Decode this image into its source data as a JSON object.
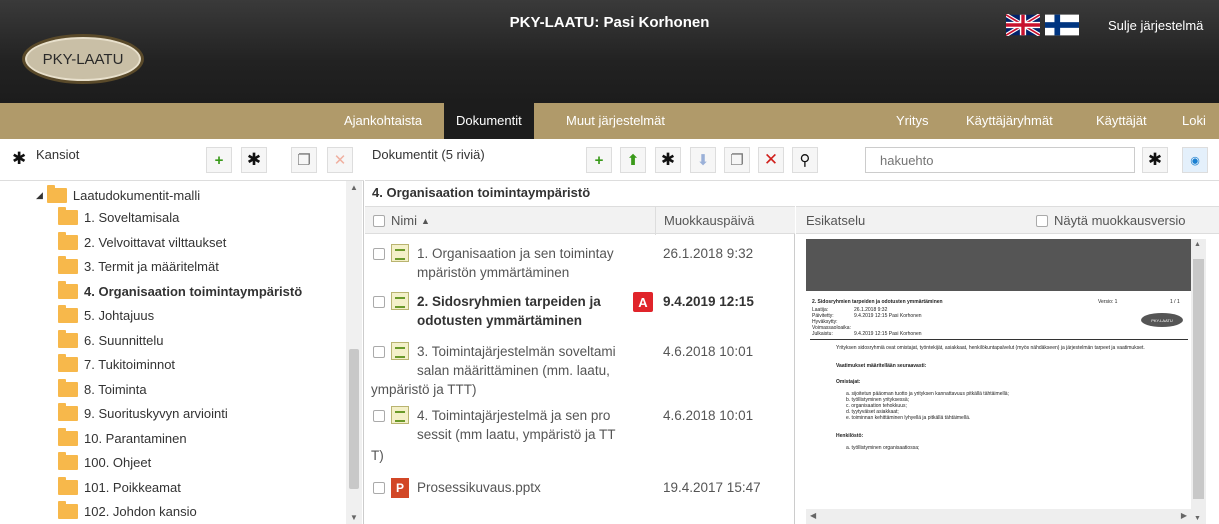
{
  "header": {
    "logo_text": "PKY-LAATU",
    "title": "PKY-LAATU: Pasi Korhonen",
    "logout_label": "Sulje järjestelmä",
    "flags": [
      "uk-flag",
      "fi-flag"
    ]
  },
  "nav": {
    "items": [
      {
        "label": "Ajankohtaista"
      },
      {
        "label": "Dokumentit",
        "active": true
      },
      {
        "label": "Muut järjestelmät"
      },
      {
        "label": "Yritys"
      },
      {
        "label": "Käyttäjäryhmät"
      },
      {
        "label": "Käyttäjät"
      },
      {
        "label": "Loki"
      }
    ]
  },
  "left_panel": {
    "title": "Kansiot",
    "root_folder": "Laatudokumentit-malli",
    "folders": [
      {
        "label": "1. Soveltamisala"
      },
      {
        "label": "2. Velvoittavat vilttaukset"
      },
      {
        "label": "3. Termit ja määritelmät"
      },
      {
        "label": "4. Organisaation toimintaympäristö",
        "selected": true
      },
      {
        "label": "5. Johtajuus"
      },
      {
        "label": "6. Suunnittelu"
      },
      {
        "label": "7. Tukitoiminnot"
      },
      {
        "label": "8. Toiminta"
      },
      {
        "label": "9. Suorituskyvyn arviointi"
      },
      {
        "label": "10. Parantaminen"
      },
      {
        "label": "100. Ohjeet"
      },
      {
        "label": "101. Poikkeamat"
      },
      {
        "label": "102. Johdon kansio"
      }
    ]
  },
  "documents": {
    "count_label": "Dokumentit (5 riviä)",
    "search_placeholder": "hakuehto",
    "section_title": "4. Organisaation toimintaympäristö",
    "col_name": "Nimi",
    "col_date": "Muokkauspäivä",
    "rows": [
      {
        "name_l1": "1. Organisaation ja sen toimintay",
        "name_l2": "mpäristön ymmärtäminen",
        "name_l3": "",
        "date": "26.1.2018 9:32",
        "bold": false,
        "type": "doc"
      },
      {
        "name_l1": "2. Sidosryhmien tarpeiden ja",
        "name_l2": "odotusten ymmärtäminen",
        "name_l3": "",
        "date": "9.4.2019 12:15",
        "bold": true,
        "type": "doc",
        "badge": "A"
      },
      {
        "name_l1": "3. Toimintajärjestelmän soveltami",
        "name_l2": "salan määrittäminen (mm. laatu,",
        "name_l3": "ympäristö ja TTT)",
        "date": "4.6.2018 10:01",
        "bold": false,
        "type": "doc"
      },
      {
        "name_l1": "4. Toimintajärjestelmä ja sen pro",
        "name_l2": "sessit (mm laatu, ympäristö ja TT",
        "name_l3": "T)",
        "date": "4.6.2018 10:01",
        "bold": false,
        "type": "doc"
      },
      {
        "name_l1": "Prosessikuvaus.pptx",
        "name_l2": "",
        "name_l3": "",
        "date": "19.4.2017 15:47",
        "bold": false,
        "type": "ppt",
        "type_letter": "P"
      }
    ]
  },
  "preview": {
    "title": "Esikatselu",
    "show_edit_label": "Näytä muokkausversio",
    "page_heading": "2. Sidosryhmien tarpeiden ja odotusten ymmärtäminen",
    "page_version": "Versio: 1",
    "page_num": "1 / 1",
    "page_logo": "PKY-LAATU",
    "meta": [
      {
        "k": "Laatija:",
        "v": "26.1.2018 9:32"
      },
      {
        "k": "Päivitetty:",
        "v": "9.4.2019 12:15    Pasi Korhonen"
      },
      {
        "k": "Hyväksytty:",
        "v": ""
      },
      {
        "k": "Voimassaoloaika:",
        "v": ""
      },
      {
        "k": "Julkaistu:",
        "v": "9.4.2019 12:15    Pasi Korhonen"
      }
    ],
    "intro": "Yrityksen sidosryhmiä ovat omistajat, työntekijät, asiakkaat, henkilökuntapalvelut (myös nähdäkseen) ja järjestelmän tarpeet ja vaatimukset.",
    "subheading": "Vaatimukset määritellään seuraavasti:",
    "owners_title": "Omistajat:",
    "owners_items": [
      "a. sijoitetun pääoman tuotto ja yrityksen kannattavuus pitkällä tähtäimellä;",
      "b. työllistyminen yrityksessä;",
      "c. organisaation tehokkuus;",
      "d. tyytyväiset asiakkaat;",
      "e. toiminnan kehittäminen lyhyellä ja pitkällä tähtäimellä."
    ],
    "staff_title": "Henkilöstö:",
    "staff_items": [
      "a. työllistyminen organisaatiossa;"
    ]
  }
}
